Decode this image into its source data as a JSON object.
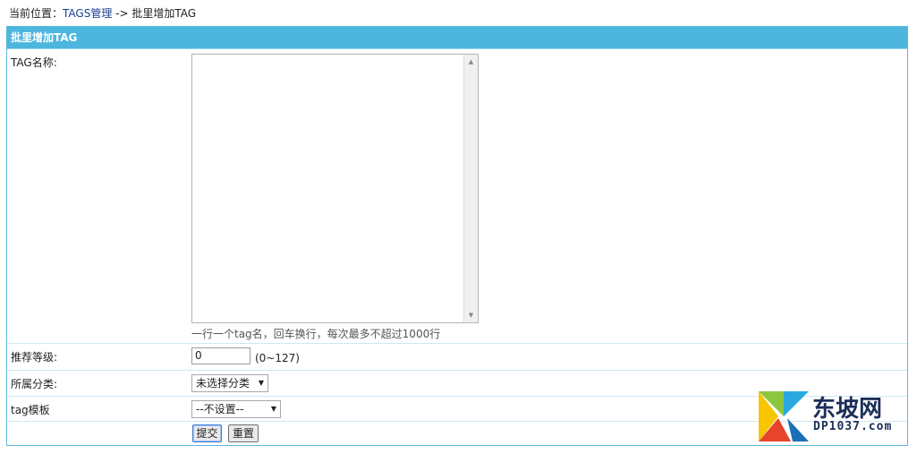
{
  "breadcrumb": {
    "prefix": "当前位置：",
    "link": "TAGS管理",
    "separator": " -> ",
    "current": "批里增加TAG"
  },
  "panel": {
    "title": "批里增加TAG"
  },
  "form": {
    "tag_name_label": "TAG名称:",
    "tag_name_value": "",
    "tag_name_hint": "一行一个tag名，回车换行，每次最多不超过1000行",
    "level_label": "推荐等级:",
    "level_value": "0",
    "level_range": "(0~127)",
    "category_label": "所属分类:",
    "category_selected": "未选择分类",
    "template_label": "tag模板",
    "template_selected": "--不设置--",
    "submit_label": "提交",
    "reset_label": "重置"
  },
  "watermark": {
    "title": "东坡网",
    "subtitle": "DP1037.com"
  },
  "colors": {
    "header_bg": "#4db6df",
    "border": "#5bb8dd",
    "link": "#1a3f8f"
  }
}
